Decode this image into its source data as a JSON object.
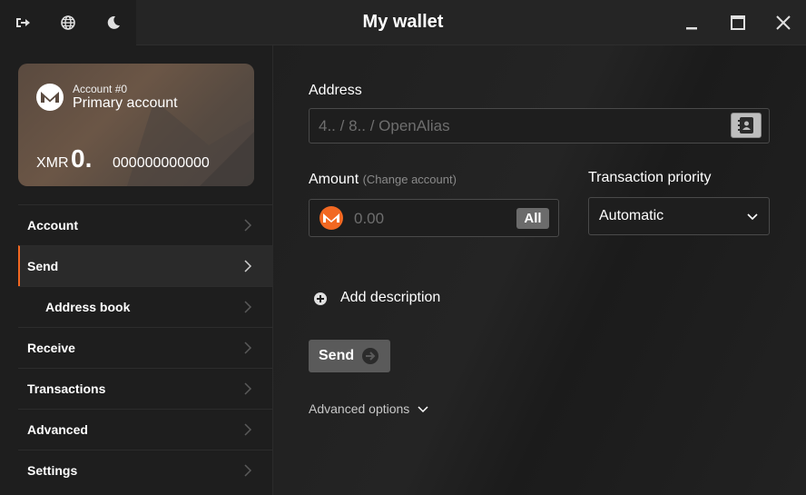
{
  "window": {
    "title": "My wallet"
  },
  "titlebar": {
    "left_icons": [
      "sign-out-icon",
      "globe-icon",
      "moon-icon"
    ],
    "right_icons": [
      "minimize-icon",
      "maximize-icon",
      "close-icon"
    ]
  },
  "account": {
    "number": "Account #0",
    "name": "Primary account",
    "currency": "XMR",
    "balance_int": "0.",
    "balance_dec": "000000000000"
  },
  "sidebar": {
    "items": [
      {
        "label": "Account",
        "sub": false,
        "active": false
      },
      {
        "label": "Send",
        "sub": false,
        "active": true
      },
      {
        "label": "Address book",
        "sub": true,
        "active": false
      },
      {
        "label": "Receive",
        "sub": false,
        "active": false
      },
      {
        "label": "Transactions",
        "sub": false,
        "active": false
      },
      {
        "label": "Advanced",
        "sub": false,
        "active": false
      },
      {
        "label": "Settings",
        "sub": false,
        "active": false
      }
    ]
  },
  "send": {
    "address_label": "Address",
    "address_placeholder": "4.. / 8.. / OpenAlias",
    "amount_label": "Amount",
    "amount_hint": "(Change account)",
    "amount_placeholder": "0.00",
    "all_label": "All",
    "priority_label": "Transaction priority",
    "priority_value": "Automatic",
    "add_description": "Add description",
    "send_label": "Send",
    "advanced_options": "Advanced options"
  },
  "colors": {
    "accent": "#f26822",
    "background": "#1c1c1c",
    "sidebar": "#1e1e1e"
  }
}
